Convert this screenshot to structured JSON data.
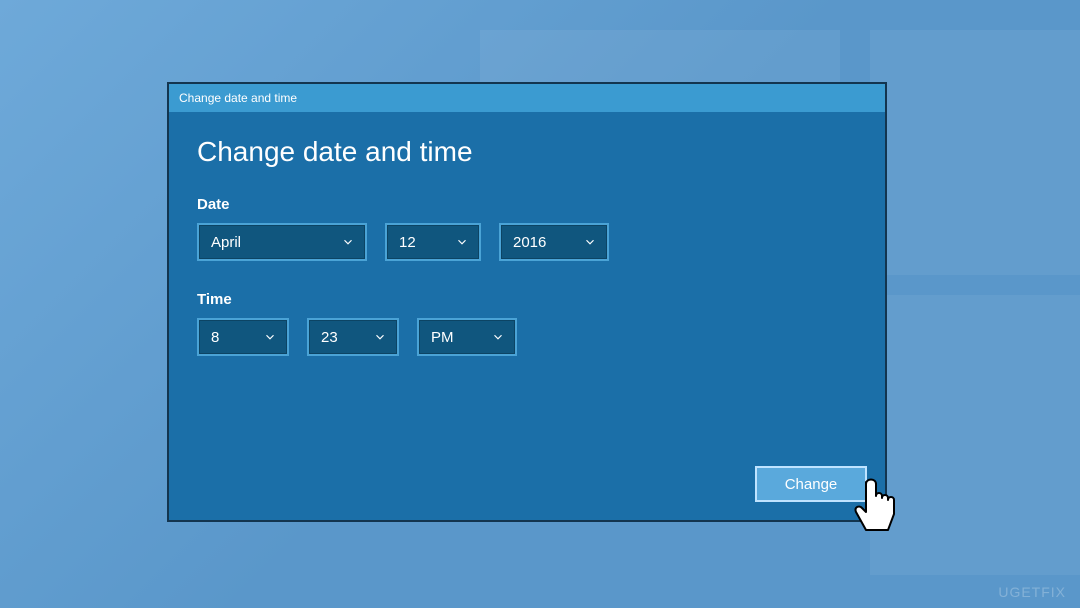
{
  "window": {
    "title": "Change date and time"
  },
  "heading": "Change date and time",
  "date": {
    "label": "Date",
    "month": "April",
    "day": "12",
    "year": "2016"
  },
  "time": {
    "label": "Time",
    "hour": "8",
    "minute": "23",
    "ampm": "PM"
  },
  "actions": {
    "change": "Change"
  },
  "watermark": "UGETFIX"
}
